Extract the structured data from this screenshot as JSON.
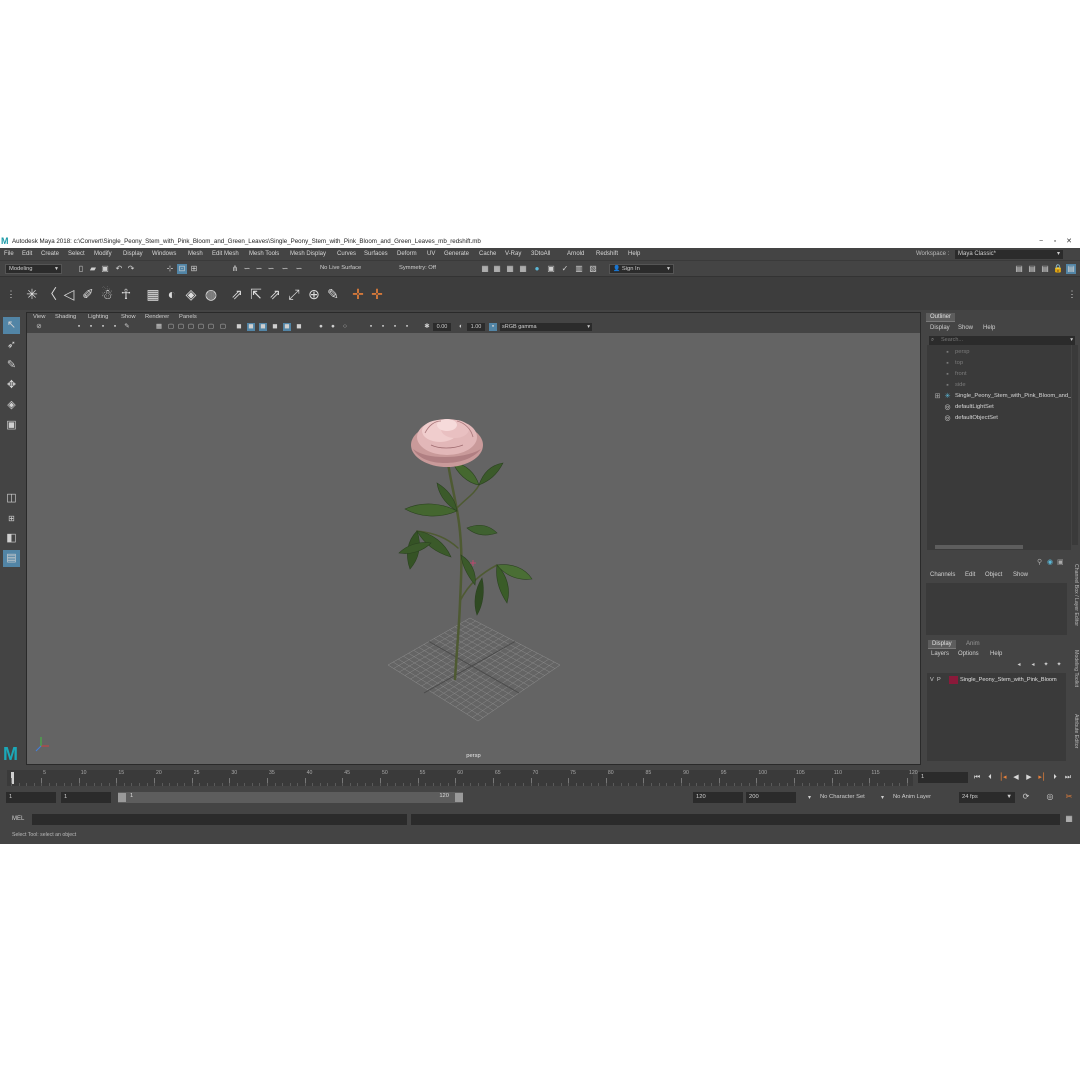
{
  "window": {
    "title": "Autodesk Maya 2018: c:\\Convert\\Single_Peony_Stem_with_Pink_Bloom_and_Green_Leaves\\Single_Peony_Stem_with_Pink_Bloom_and_Green_Leaves_mb_redshift.mb",
    "logo": "M",
    "minimize": "−",
    "maximize": "▫",
    "close": "✕"
  },
  "menu": {
    "items": [
      "File",
      "Edit",
      "Create",
      "Select",
      "Modify",
      "Display",
      "Windows",
      "Mesh",
      "Edit Mesh",
      "Mesh Tools",
      "Mesh Display",
      "Curves",
      "Surfaces",
      "Deform",
      "UV",
      "Generate",
      "Cache",
      "V-Ray",
      "3DtoAll",
      "Arnold",
      "Redshift",
      "Help"
    ],
    "workspace_label": "Workspace :",
    "workspace_value": "Maya Classic*"
  },
  "status": {
    "menuset": "Modeling",
    "live_surface": "No Live Surface",
    "symmetry": "Symmetry: Off",
    "sign_in": "Sign In"
  },
  "viewport": {
    "menus": [
      "View",
      "Shading",
      "Lighting",
      "Show",
      "Renderer",
      "Panels"
    ],
    "exposure": "0.00",
    "gamma": "1.00",
    "color_space": "sRGB gamma",
    "camera_label": "persp"
  },
  "outliner": {
    "title": "Outliner",
    "menus": [
      "Display",
      "Show",
      "Help"
    ],
    "search_placeholder": "Search...",
    "items": [
      {
        "label": "persp",
        "icon": "camera-icon",
        "dim": true
      },
      {
        "label": "top",
        "icon": "camera-icon",
        "dim": true
      },
      {
        "label": "front",
        "icon": "camera-icon",
        "dim": true
      },
      {
        "label": "side",
        "icon": "camera-icon",
        "dim": true
      },
      {
        "label": "Single_Peony_Stem_with_Pink_Bloom_and_Green_Leaves",
        "icon": "transform-icon",
        "dim": false
      },
      {
        "label": "defaultLightSet",
        "icon": "set-icon",
        "dim": false
      },
      {
        "label": "defaultObjectSet",
        "icon": "set-icon",
        "dim": false
      }
    ]
  },
  "channel_box": {
    "menus": [
      "Channels",
      "Edit",
      "Object",
      "Show"
    ]
  },
  "layer_editor": {
    "tabs": [
      "Display",
      "Anim"
    ],
    "menus": [
      "Layers",
      "Options",
      "Help"
    ],
    "layer": {
      "v": "V",
      "p": "P",
      "name": "Single_Peony_Stem_with_Pink_Bloom",
      "color": "#8a1a3a"
    }
  },
  "side_tabs": [
    "Channel Box / Layer Editor",
    "Modeling Toolkit",
    "Attribute Editor"
  ],
  "time": {
    "ticks": [
      "1",
      "5",
      "10",
      "15",
      "20",
      "25",
      "30",
      "35",
      "40",
      "45",
      "50",
      "55",
      "60",
      "65",
      "70",
      "75",
      "80",
      "85",
      "90",
      "95",
      "100",
      "105",
      "110",
      "115",
      "120"
    ],
    "current_frame": "1",
    "range_start": "1",
    "range_start_inner": "1",
    "slider_start": "1",
    "slider_end": "120",
    "range_end_inner": "120",
    "range_end": "200",
    "character_set": "No Character Set",
    "anim_layer": "No Anim Layer",
    "fps": "24 fps"
  },
  "command": {
    "language": "MEL"
  },
  "help_line": "Select Tool: select an object",
  "colors": {
    "accent": "#5285a6",
    "maya_teal": "#1ba8b8",
    "viewport_bg": "#646464"
  }
}
